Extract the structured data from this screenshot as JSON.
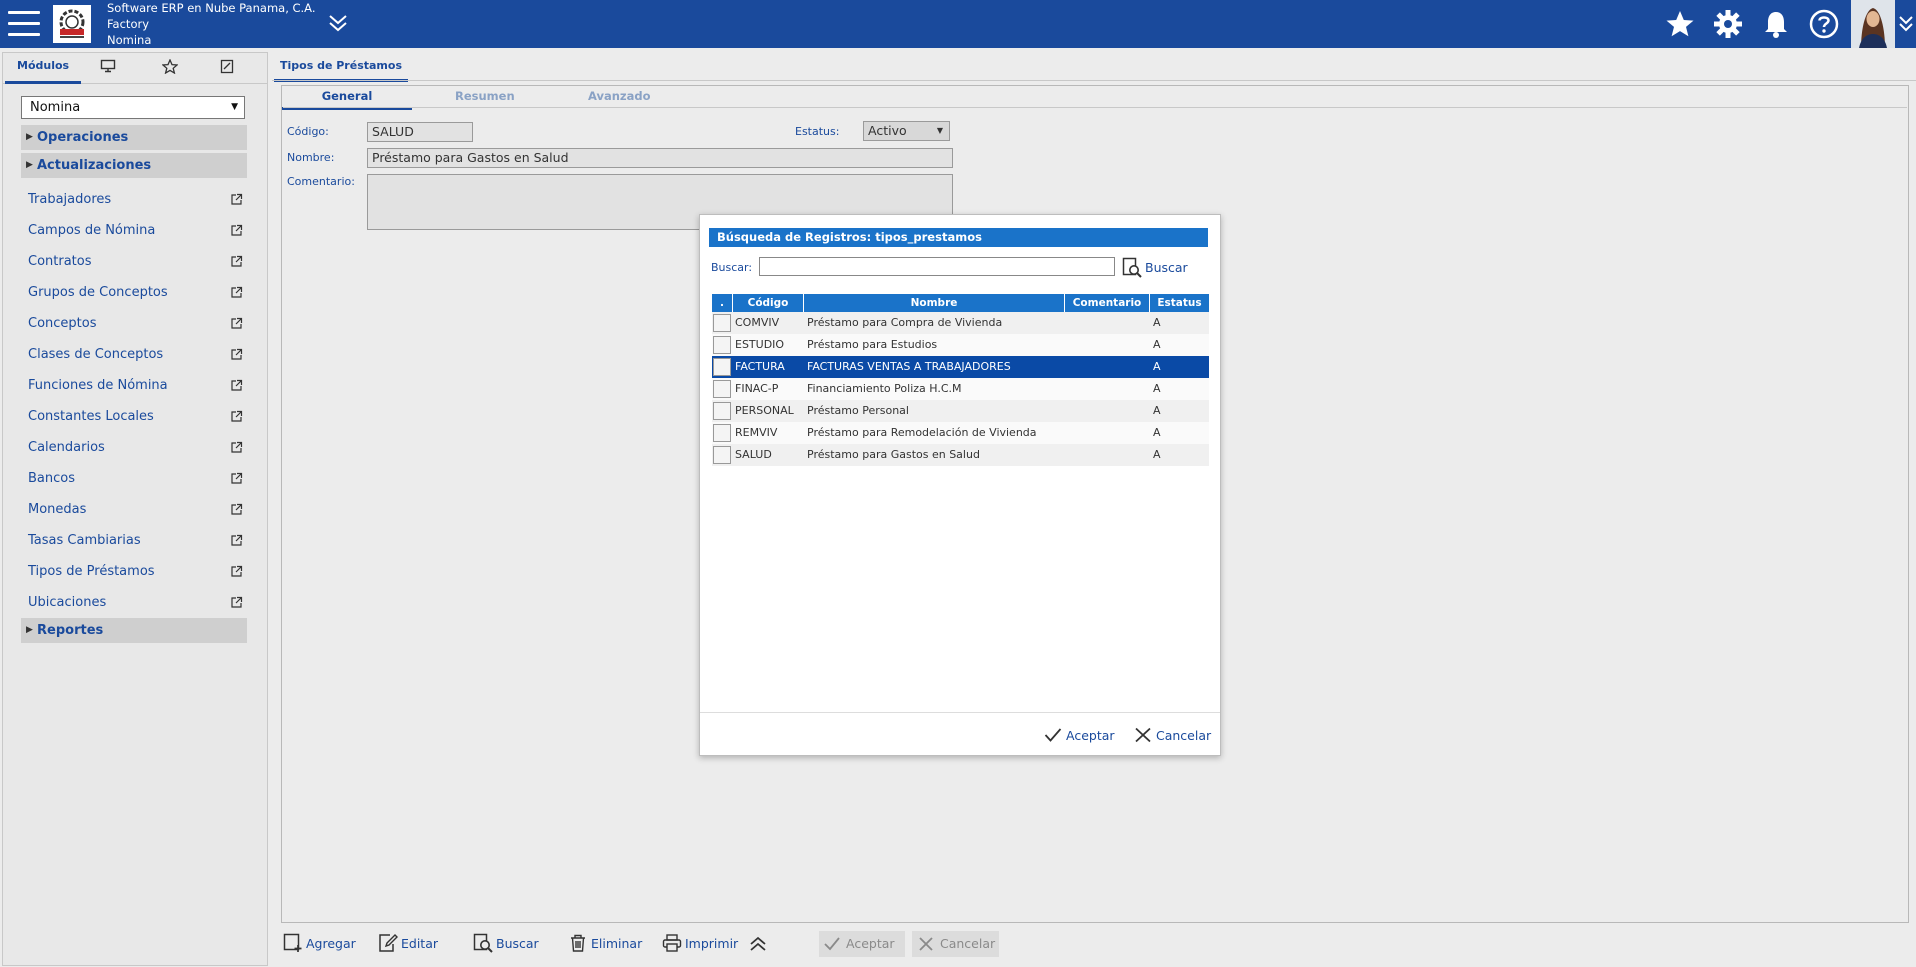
{
  "header": {
    "company": "Software ERP en Nube Panama, C.A.",
    "site": "Factory",
    "module": "Nomina",
    "icons": [
      "menu-icon",
      "double-chevron-down-icon",
      "star-icon",
      "gear-icon",
      "bell-icon",
      "help-icon",
      "chevron-down-icon"
    ]
  },
  "sidebar": {
    "tabs": {
      "modules": "Módulos"
    },
    "module_select": "Nomina",
    "sections": {
      "operaciones": "Operaciones",
      "actualizaciones": "Actualizaciones",
      "reportes": "Reportes"
    },
    "items": [
      "Trabajadores",
      "Campos de Nómina",
      "Contratos",
      "Grupos de Conceptos",
      "Conceptos",
      "Clases de Conceptos",
      "Funciones de Nómina",
      "Constantes Locales",
      "Calendarios",
      "Bancos",
      "Monedas",
      "Tasas Cambiarias",
      "Tipos de Préstamos",
      "Ubicaciones"
    ]
  },
  "main": {
    "tab": "Tipos de Préstamos",
    "subtabs": [
      "General",
      "Resumen",
      "Avanzado"
    ],
    "form": {
      "codigo_label": "Código:",
      "codigo_value": "SALUD",
      "estatus_label": "Estatus:",
      "estatus_value": "Activo",
      "nombre_label": "Nombre:",
      "nombre_value": "Préstamo para Gastos en Salud",
      "comentario_label": "Comentario:",
      "comentario_value": ""
    },
    "toolbar": {
      "agregar": "Agregar",
      "editar": "Editar",
      "buscar": "Buscar",
      "eliminar": "Eliminar",
      "imprimir": "Imprimir",
      "aceptar": "Aceptar",
      "cancelar": "Cancelar"
    }
  },
  "dialog": {
    "title": "Búsqueda de Registros: tipos_prestamos",
    "search_label": "Buscar:",
    "search_value": "",
    "search_button": "Buscar",
    "columns": [
      ".",
      "Código",
      "Nombre",
      "Comentario",
      "Estatus"
    ],
    "rows": [
      {
        "codigo": "COMVIV",
        "nombre": "Préstamo para Compra de Vivienda",
        "comentario": "",
        "estatus": "A"
      },
      {
        "codigo": "ESTUDIO",
        "nombre": "Préstamo para Estudios",
        "comentario": "",
        "estatus": "A"
      },
      {
        "codigo": "FACTURA",
        "nombre": "FACTURAS VENTAS A TRABAJADORES",
        "comentario": "",
        "estatus": "A"
      },
      {
        "codigo": "FINAC-P",
        "nombre": "Financiamiento Poliza H.C.M",
        "comentario": "",
        "estatus": "A"
      },
      {
        "codigo": "PERSONAL",
        "nombre": "Préstamo Personal",
        "comentario": "",
        "estatus": "A"
      },
      {
        "codigo": "REMVIV",
        "nombre": "Préstamo para Remodelación de Vivienda",
        "comentario": "",
        "estatus": "A"
      },
      {
        "codigo": "SALUD",
        "nombre": "Préstamo para Gastos en Salud",
        "comentario": "",
        "estatus": "A"
      }
    ],
    "selected_row": 2,
    "accept": "Aceptar",
    "cancel": "Cancelar"
  },
  "colors": {
    "brand": "#1a4a9c",
    "header_blue": "#1a73c9",
    "selected_row": "#0a4aa6"
  }
}
